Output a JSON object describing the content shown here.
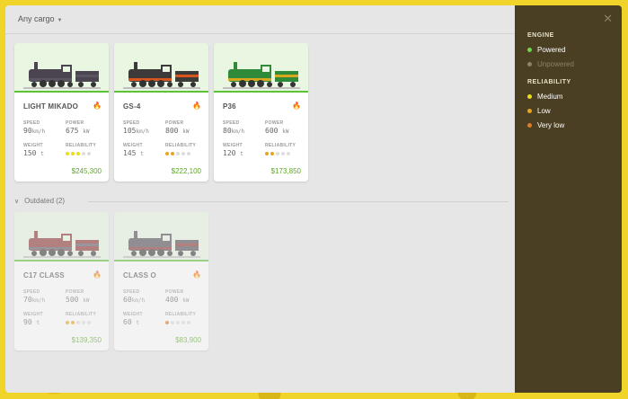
{
  "filter": {
    "label": "Any cargo"
  },
  "legend": {
    "engine_title": "ENGINE",
    "engine": [
      {
        "label": "Powered",
        "color": "#6fd64a",
        "dim": false
      },
      {
        "label": "Unpowered",
        "color": "#8b8266",
        "dim": true
      }
    ],
    "reliability_title": "RELIABILITY",
    "reliability": [
      {
        "label": "Medium",
        "color": "#e9df1b"
      },
      {
        "label": "Low",
        "color": "#e6a51d"
      },
      {
        "label": "Very low",
        "color": "#e07a25"
      }
    ]
  },
  "labels": {
    "speed": "SPEED",
    "power": "POWER",
    "weight": "WEIGHT",
    "reliability": "RELIABILITY",
    "speed_unit": "km/h",
    "power_unit": "kW",
    "weight_unit": "t"
  },
  "trains": [
    {
      "name": "LIGHT MIKADO",
      "speed": "90",
      "power": "675",
      "weight": "150",
      "price": "$245,300",
      "reliability": 3,
      "rel_color": "#e9df1b",
      "body": "#4a4550",
      "accent": "#5a5560"
    },
    {
      "name": "GS-4",
      "speed": "105",
      "power": "800",
      "weight": "145",
      "price": "$222,100",
      "reliability": 2,
      "rel_color": "#e6a51d",
      "body": "#3d3a3a",
      "accent": "#d9561f"
    },
    {
      "name": "P36",
      "speed": "80",
      "power": "600",
      "weight": "120",
      "price": "$173,850",
      "reliability": 2,
      "rel_color": "#e6a51d",
      "body": "#2f8a3a",
      "accent": "#d9a81f"
    }
  ],
  "outdated_section": {
    "label": "Outdated (2)"
  },
  "outdated": [
    {
      "name": "C17 CLASS",
      "speed": "70",
      "power": "500",
      "weight": "90",
      "price": "$139,350",
      "reliability": 2,
      "rel_color": "#e6a51d",
      "body": "#8a2e2e",
      "accent": "#5a5560"
    },
    {
      "name": "CLASS O",
      "speed": "60",
      "power": "400",
      "weight": "60",
      "price": "$83,900",
      "reliability": 1,
      "rel_color": "#e07a25",
      "body": "#4a4550",
      "accent": "#8a2e2e"
    }
  ]
}
